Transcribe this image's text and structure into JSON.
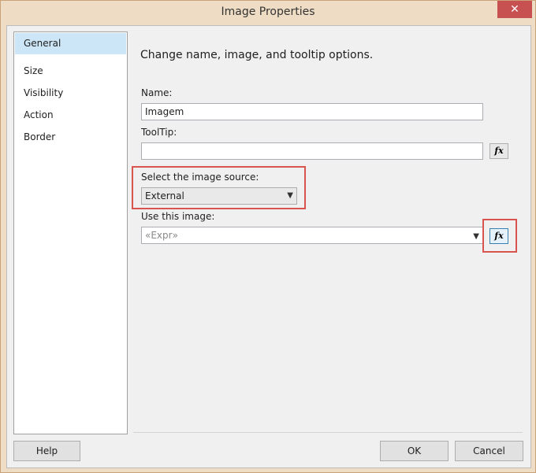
{
  "window": {
    "title": "Image Properties",
    "close_label": "✕"
  },
  "sidebar": {
    "items": [
      {
        "label": "General"
      },
      {
        "label": "Size"
      },
      {
        "label": "Visibility"
      },
      {
        "label": "Action"
      },
      {
        "label": "Border"
      }
    ],
    "active_index": 0
  },
  "main": {
    "heading": "Change name, image, and tooltip options.",
    "name": {
      "label": "Name:",
      "value": "Imagem"
    },
    "tooltip": {
      "label": "ToolTip:",
      "value": "",
      "fx": "fx"
    },
    "source": {
      "label": "Select the image source:",
      "selected": "External"
    },
    "image": {
      "label": "Use this image:",
      "placeholder": "«Expr»",
      "fx": "fx"
    }
  },
  "footer": {
    "help": "Help",
    "ok": "OK",
    "cancel": "Cancel"
  },
  "colors": {
    "highlight_box": "#d9534f",
    "selected_nav": "#cde6f7"
  }
}
